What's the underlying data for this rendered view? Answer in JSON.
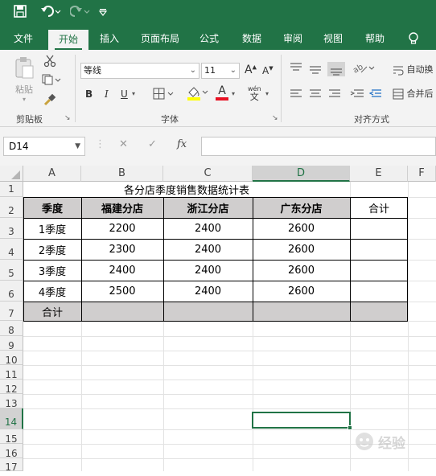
{
  "quick_access": {
    "save_icon": "save-icon",
    "undo_icon": "undo-icon",
    "redo_icon": "redo-icon",
    "customize_icon": "customize-icon"
  },
  "tabs": [
    {
      "label": "文件",
      "active": false
    },
    {
      "label": "开始",
      "active": true
    },
    {
      "label": "插入",
      "active": false
    },
    {
      "label": "页面布局",
      "active": false
    },
    {
      "label": "公式",
      "active": false
    },
    {
      "label": "数据",
      "active": false
    },
    {
      "label": "审阅",
      "active": false
    },
    {
      "label": "视图",
      "active": false
    },
    {
      "label": "帮助",
      "active": false
    }
  ],
  "ribbon": {
    "clipboard": {
      "paste": "粘贴",
      "label": "剪贴板"
    },
    "font": {
      "name": "等线",
      "size": "11",
      "bold": "B",
      "italic": "I",
      "underline": "U",
      "font_color_letter": "A",
      "wen": "wén",
      "wen_char": "文",
      "grow": "A",
      "shrink": "A",
      "label": "字体",
      "font_color": "#e81123"
    },
    "alignment": {
      "wrap": "自动换",
      "merge": "合并后",
      "label": "对齐方式"
    }
  },
  "formula_bar": {
    "name_box": "D14",
    "fx": "fx",
    "value": ""
  },
  "columns": [
    "A",
    "B",
    "C",
    "D",
    "E",
    "F"
  ],
  "rows": [
    "1",
    "2",
    "3",
    "4",
    "5",
    "6",
    "7",
    "8",
    "9",
    "10",
    "11",
    "12",
    "13",
    "14",
    "15",
    "16",
    "17"
  ],
  "sheet": {
    "title": "各分店季度销售数据统计表",
    "headers": [
      "季度",
      "福建分店",
      "浙江分店",
      "广东分店",
      "合计"
    ],
    "data": [
      [
        "1季度",
        "2200",
        "2400",
        "2600",
        ""
      ],
      [
        "2季度",
        "2300",
        "2400",
        "2600",
        ""
      ],
      [
        "3季度",
        "2400",
        "2400",
        "2600",
        ""
      ],
      [
        "4季度",
        "2500",
        "2400",
        "2600",
        ""
      ]
    ],
    "total_label": "合计"
  },
  "watermark": "经验",
  "colors": {
    "excel_green": "#217346",
    "header_gray": "#d0cece",
    "selection": "#217346"
  }
}
